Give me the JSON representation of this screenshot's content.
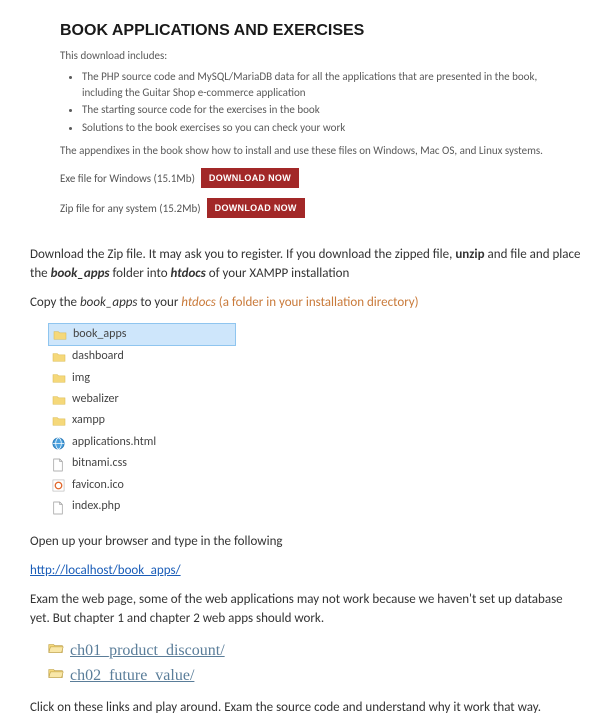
{
  "header": {
    "title": "BOOK APPLICATIONS AND EXERCISES",
    "intro": "This download includes:",
    "bullets": [
      "The PHP source code and MySQL/MariaDB data for all the applications that are presented in the book, including the Guitar Shop e-commerce application",
      "The starting source code for the exercises in the book",
      "Solutions to the book exercises so you can check your work"
    ],
    "appendix": "The appendixes in the book show how to install and use these files on Windows, Mac OS, and Linux systems.",
    "exe_label": "Exe file for Windows (15.1Mb)",
    "zip_label": "Zip file for any system (15.2Mb)",
    "download_btn": "DOWNLOAD NOW"
  },
  "instructions": {
    "p1_a": "Download the Zip file. It may ask you to register. If you download the zipped file, ",
    "p1_b": "unzip",
    "p1_c": " and file and place the ",
    "p1_d": "book_apps",
    "p1_e": " folder into ",
    "p1_f": "htdocs",
    "p1_g": " of your XAMPP installation",
    "p2_a": "Copy the ",
    "p2_b": "book_apps",
    "p2_c": " to your ",
    "p2_d": "htdocs",
    "p2_e": " (a folder in your installation directory)",
    "p3": "Open up your browser and type in the following",
    "url": "http://localhost/book_apps/",
    "p4": "Exam the web page, some of the web applications may not work because we haven't set up database yet. But chapter 1 and chapter 2 web apps should work.",
    "p5": "Click on these links and play around. Exam the source code and understand why it work that way."
  },
  "files": [
    {
      "name": "book_apps",
      "type": "folder",
      "selected": true
    },
    {
      "name": "dashboard",
      "type": "folder",
      "selected": false
    },
    {
      "name": "img",
      "type": "folder",
      "selected": false
    },
    {
      "name": "webalizer",
      "type": "folder",
      "selected": false
    },
    {
      "name": "xampp",
      "type": "folder",
      "selected": false
    },
    {
      "name": "applications.html",
      "type": "globe",
      "selected": false
    },
    {
      "name": "bitnami.css",
      "type": "file",
      "selected": false
    },
    {
      "name": "favicon.ico",
      "type": "edge",
      "selected": false
    },
    {
      "name": "index.php",
      "type": "file",
      "selected": false
    }
  ],
  "app_links": [
    "ch01_product_discount/",
    "ch02_future_value/"
  ]
}
